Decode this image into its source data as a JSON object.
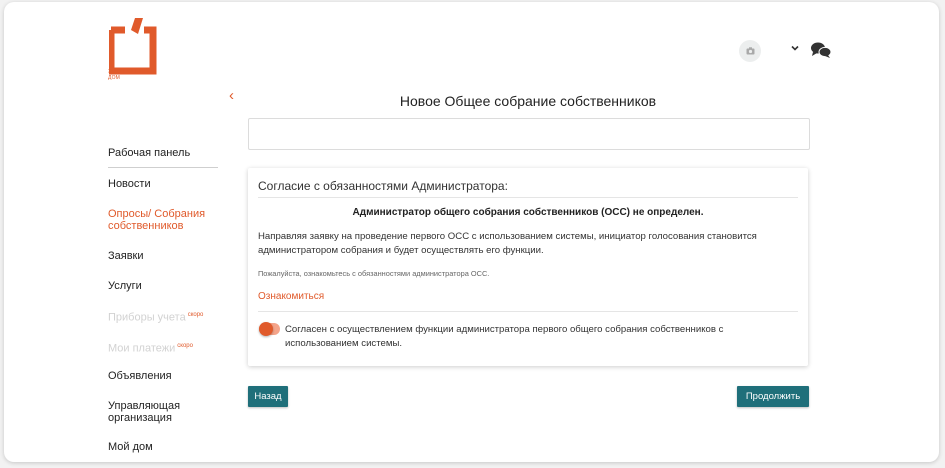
{
  "brand": {
    "logo_text_line1": "ЭЛЕКТРОННЫЙ",
    "logo_text_line2": "ДОМ",
    "accent_color": "#e05a2b",
    "primary_button_color": "#1f6f7a"
  },
  "header": {
    "icons": [
      "camera-icon",
      "chevron-down-icon",
      "chat-icon"
    ]
  },
  "sidebar": {
    "items": [
      {
        "label": "Рабочая панель",
        "state": "normal"
      },
      {
        "label": "Новости",
        "state": "normal"
      },
      {
        "label": "Опросы/ Собрания собственников",
        "state": "active"
      },
      {
        "label": "Заявки",
        "state": "normal"
      },
      {
        "label": "Услуги",
        "state": "normal"
      },
      {
        "label": "Приборы учета",
        "badge": "скоро",
        "state": "disabled"
      },
      {
        "label": "Мои платежи",
        "badge": "скоро",
        "state": "disabled"
      },
      {
        "label": "Объявления",
        "state": "normal"
      },
      {
        "label": "Управляющая организация",
        "state": "normal"
      },
      {
        "label": "Мой дом",
        "state": "normal"
      }
    ]
  },
  "main": {
    "title": "Новое Общее собрание собственников",
    "title_field_value": "",
    "card": {
      "header": "Согласие с обязанностями Администратора:",
      "bold_notice": "Администратор общего собрания собственников (ОСС) не определен.",
      "paragraph": "Направляя заявку на проведение первого ОСС с использованием системы, инициатор голосования становится администратором собрания и будет осуществлять его функции.",
      "small_note": "Пожалуйста, ознакомьтесь с обязанностями администратора ОСС.",
      "link": "Ознакомиться",
      "consent_text": "Согласен с осуществлением функции администратора первого общего собрания собственников с использованием системы.",
      "consent_on": true
    },
    "back_label": "Назад",
    "next_label": "Продолжить"
  }
}
